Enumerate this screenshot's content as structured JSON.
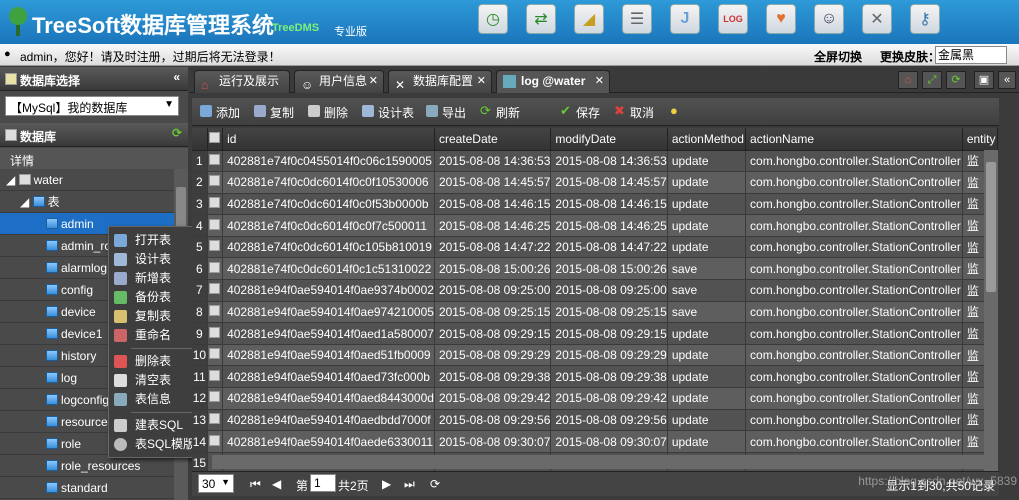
{
  "header": {
    "title": "TreeSoft数据库管理系统",
    "subtitle": "TreeDMS",
    "edition": "专业版",
    "icons": [
      "clock-icon",
      "arrows-icon",
      "chart-icon",
      "database-icon",
      "letter-j-icon",
      "log-icon",
      "heart-icon",
      "user-icon",
      "tools-icon",
      "key-icon"
    ]
  },
  "userbar": {
    "message": "admin，您好！请及时注册，过期后将无法登录！",
    "fullscreen": "全屏切换",
    "skin_label": "更换皮肤：",
    "skin_value": "金属黑"
  },
  "left": {
    "db_select_title": "数据库选择",
    "db_select_value": "【MySql】我的数据库",
    "db_title": "数据库",
    "detail": "详情",
    "tree": [
      {
        "label": "water",
        "level": 0
      },
      {
        "label": "表",
        "level": 1
      },
      {
        "label": "admin",
        "level": 2
      },
      {
        "label": "admin_ro",
        "level": 2
      },
      {
        "label": "alarmlog",
        "level": 2
      },
      {
        "label": "config",
        "level": 2
      },
      {
        "label": "device",
        "level": 2
      },
      {
        "label": "device1",
        "level": 2
      },
      {
        "label": "history",
        "level": 2
      },
      {
        "label": "log",
        "level": 2
      },
      {
        "label": "logconfig",
        "level": 2
      },
      {
        "label": "resources",
        "level": 2
      },
      {
        "label": "role",
        "level": 2
      },
      {
        "label": "role_resources",
        "level": 2
      },
      {
        "label": "standard",
        "level": 2
      }
    ]
  },
  "context_menu": {
    "items": [
      "打开表",
      "设计表",
      "新增表",
      "备份表",
      "复制表",
      "重命名",
      "删除表",
      "清空表",
      "表信息",
      "建表SQL",
      "表SQL模版"
    ]
  },
  "tabs": [
    {
      "label": "运行及展示"
    },
    {
      "label": "用户信息"
    },
    {
      "label": "数据库配置"
    },
    {
      "label": "log @water"
    }
  ],
  "toolbar": {
    "add": "添加",
    "copy": "复制",
    "delete": "删除",
    "design": "设计表",
    "export": "导出",
    "refresh": "刷新",
    "save": "保存",
    "cancel": "取消"
  },
  "grid": {
    "columns": [
      "id",
      "createDate",
      "modifyDate",
      "actionMethod",
      "actionName",
      "entity"
    ],
    "rows": [
      [
        "1",
        "402881e74f0c0455014f0c06c1590005",
        "2015-08-08 14:36:53",
        "2015-08-08 14:36:53",
        "update",
        "com.hongbo.controller.StationController",
        "监"
      ],
      [
        "2",
        "402881e74f0c0dc6014f0c0f10530006",
        "2015-08-08 14:45:57",
        "2015-08-08 14:45:57",
        "update",
        "com.hongbo.controller.StationController",
        "监"
      ],
      [
        "3",
        "402881e74f0c0dc6014f0c0f53b0000b",
        "2015-08-08 14:46:15",
        "2015-08-08 14:46:15",
        "update",
        "com.hongbo.controller.StationController",
        "监"
      ],
      [
        "4",
        "402881e74f0c0dc6014f0c0f7c500011",
        "2015-08-08 14:46:25",
        "2015-08-08 14:46:25",
        "update",
        "com.hongbo.controller.StationController",
        "监"
      ],
      [
        "5",
        "402881e74f0c0dc6014f0c105b810019",
        "2015-08-08 14:47:22",
        "2015-08-08 14:47:22",
        "update",
        "com.hongbo.controller.StationController",
        "监"
      ],
      [
        "6",
        "402881e74f0c0dc6014f0c1c51310022",
        "2015-08-08 15:00:26",
        "2015-08-08 15:00:26",
        "save",
        "com.hongbo.controller.StationController",
        "监"
      ],
      [
        "7",
        "402881e94f0ae594014f0ae9374b0002",
        "2015-08-08 09:25:00",
        "2015-08-08 09:25:00",
        "save",
        "com.hongbo.controller.StationController",
        "监"
      ],
      [
        "8",
        "402881e94f0ae594014f0ae974210005",
        "2015-08-08 09:25:15",
        "2015-08-08 09:25:15",
        "save",
        "com.hongbo.controller.StationController",
        "监"
      ],
      [
        "9",
        "402881e94f0ae594014f0aed1a580007",
        "2015-08-08 09:29:15",
        "2015-08-08 09:29:15",
        "update",
        "com.hongbo.controller.StationController",
        "监"
      ],
      [
        "10",
        "402881e94f0ae594014f0aed51fb0009",
        "2015-08-08 09:29:29",
        "2015-08-08 09:29:29",
        "update",
        "com.hongbo.controller.StationController",
        "监"
      ],
      [
        "11",
        "402881e94f0ae594014f0aed73fc000b",
        "2015-08-08 09:29:38",
        "2015-08-08 09:29:38",
        "update",
        "com.hongbo.controller.StationController",
        "监"
      ],
      [
        "12",
        "402881e94f0ae594014f0aed8443000d",
        "2015-08-08 09:29:42",
        "2015-08-08 09:29:42",
        "update",
        "com.hongbo.controller.StationController",
        "监"
      ],
      [
        "13",
        "402881e94f0ae594014f0aedbdd7000f",
        "2015-08-08 09:29:56",
        "2015-08-08 09:29:56",
        "update",
        "com.hongbo.controller.StationController",
        "监"
      ],
      [
        "14",
        "402881e94f0ae594014f0aede6330011",
        "2015-08-08 09:30:07",
        "2015-08-08 09:30:07",
        "update",
        "com.hongbo.controller.StationController",
        "监"
      ],
      [
        "15",
        "",
        "",
        "",
        "",
        "",
        ""
      ]
    ]
  },
  "pager": {
    "page_size": "30",
    "page_prefix": "第",
    "page_num": "1",
    "page_suffix": "共2页",
    "info": "显示1到30,共50记录"
  },
  "watermark": "https://blog.csdn.net/wx_5839"
}
